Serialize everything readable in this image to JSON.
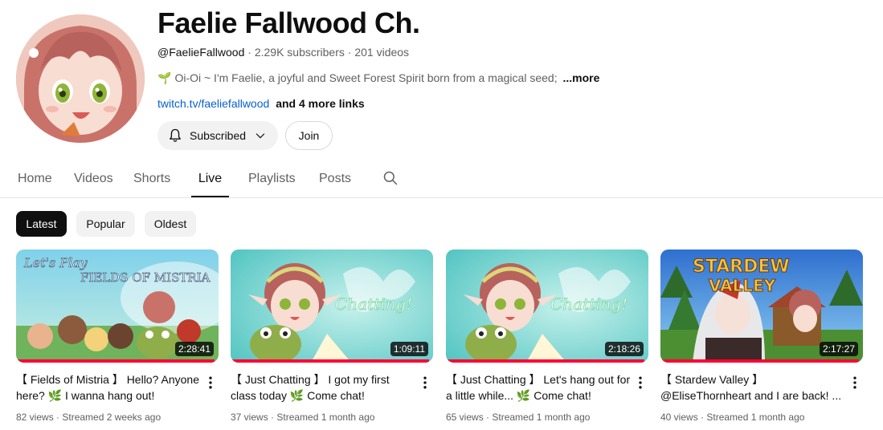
{
  "channel": {
    "name": "Faelie Fallwood Ch.",
    "handle": "@FaelieFallwood",
    "subscribers": "2.29K subscribers",
    "videos": "201 videos",
    "separator": "·",
    "description": "Oi-Oi ~ I'm Faelie, a joyful and Sweet Forest Spirit born from a magical seed;",
    "more": "...more",
    "link": "twitch.tv/faeliefallwood",
    "more_links": "and 4 more links"
  },
  "buttons": {
    "subscribed": "Subscribed",
    "join": "Join"
  },
  "tabs": [
    {
      "label": "Home",
      "active": false
    },
    {
      "label": "Videos",
      "active": false
    },
    {
      "label": "Shorts",
      "active": false
    },
    {
      "label": "Live",
      "active": true
    },
    {
      "label": "Playlists",
      "active": false
    },
    {
      "label": "Posts",
      "active": false
    }
  ],
  "chips": [
    {
      "label": "Latest",
      "active": true
    },
    {
      "label": "Popular",
      "active": false
    },
    {
      "label": "Oldest",
      "active": false
    }
  ],
  "videos": [
    {
      "title": "【 Fields of Mistria 】 Hello? Anyone here? 🌿 I wanna hang out!",
      "duration": "2:28:41",
      "views": "82 views",
      "streamed": "Streamed 2 weeks ago",
      "thumb_text": "Let's Play FIELDS OF MISTRIA",
      "watched": 0.98
    },
    {
      "title": "【 Just Chatting 】 I got my first class today 🌿 Come chat!",
      "duration": "1:09:11",
      "views": "37 views",
      "streamed": "Streamed 1 month ago",
      "thumb_text": "Chatting!",
      "watched": 0.98
    },
    {
      "title": "【 Just Chatting 】 Let's hang out for a little while... 🌿 Come chat!",
      "duration": "2:18:26",
      "views": "65 views",
      "streamed": "Streamed 1 month ago",
      "thumb_text": "Chatting!",
      "watched": 0.98
    },
    {
      "title": "【 Stardew Valley 】 @EliseThornheart and I are back! ...",
      "duration": "2:17:27",
      "views": "40 views",
      "streamed": "Streamed 1 month ago",
      "thumb_text": "STARDEW VALLEY",
      "watched": 0.98
    }
  ],
  "colors": {
    "link": "#065fd4",
    "progress": "#ff0033",
    "chip_active": "#0f0f0f",
    "chip": "#f2f2f2"
  },
  "icons": {
    "notification": "bell-icon",
    "dropdown": "chevron-down-icon",
    "search": "search-icon",
    "menu": "more-vertical-icon",
    "sprout": "sprout-icon"
  }
}
